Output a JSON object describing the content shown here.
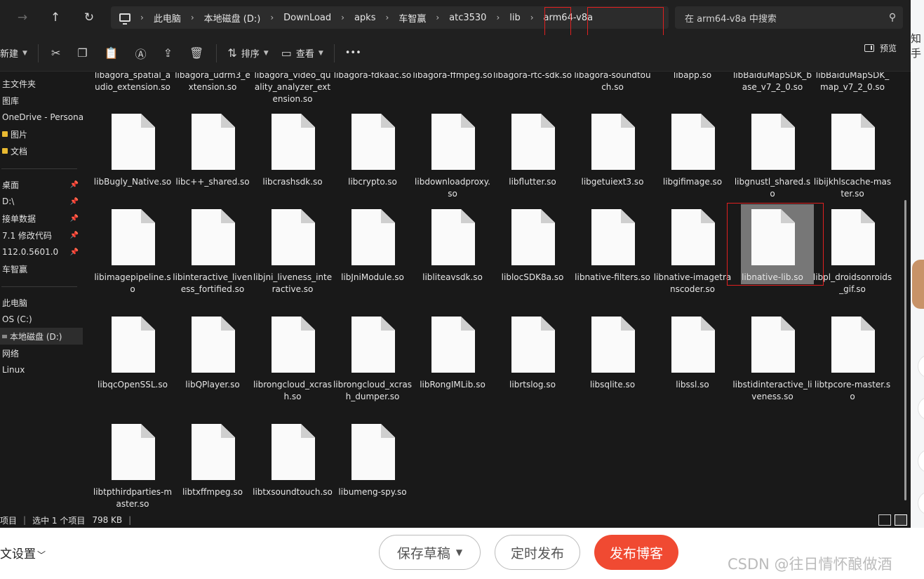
{
  "background": {
    "right_edge_text": "知手",
    "article_settings": "文设置",
    "save_draft": "保存草稿",
    "schedule": "定时发布",
    "publish": "发布博客",
    "watermark": "CSDN @往日情怀酿做酒"
  },
  "address_bar": {
    "breadcrumbs": [
      "此电脑",
      "本地磁盘 (D:)",
      "DownLoad",
      "apks",
      "车智赢",
      "atc3530",
      "lib",
      "arm64-v8a"
    ],
    "search_placeholder": "在 arm64-v8a 中搜索"
  },
  "toolbar": {
    "new": "新建",
    "sort": "排序",
    "view": "查看",
    "more": "•••",
    "preview": "预览"
  },
  "sidebar": {
    "items": [
      "主文件夹",
      "图库",
      "OneDrive - Persona",
      "图片",
      "文档",
      "桌面",
      "D:\\",
      "接单数据",
      "7.1 修改代码",
      "112.0.5601.0",
      "车智赢",
      "此电脑",
      "OS (C:)",
      "本地磁盘 (D:)",
      "网络",
      "Linux"
    ]
  },
  "files": {
    "row0": [
      "libagora_spatial_audio_extension.so",
      "libagora_udrm3_extension.so",
      "libagora_video_quality_analyzer_extension.so",
      "libagora-fdkaac.so",
      "libagora-ffmpeg.so",
      "libagora-rtc-sdk.so",
      "libagora-soundtouch.so",
      "libapp.so",
      "libBaiduMapSDK_base_v7_2_0.so",
      "libBaiduMapSDK_map_v7_2_0.so"
    ],
    "row1": [
      "libBugly_Native.so",
      "libc++_shared.so",
      "libcrashsdk.so",
      "libcrypto.so",
      "libdownloadproxy.so",
      "libflutter.so",
      "libgetuiext3.so",
      "libgifimage.so",
      "libgnustl_shared.so",
      "libijkhlscache-master.so"
    ],
    "row2": [
      "libimagepipeline.so",
      "libinteractive_liveness_fortified.so",
      "libjni_liveness_interactive.so",
      "libJniModule.so",
      "libliteavsdk.so",
      "liblocSDK8a.so",
      "libnative-filters.so",
      "libnative-imagetranscoder.so",
      "libnative-lib.so",
      "libpl_droidsonroids_gif.so"
    ],
    "row3": [
      "libqcOpenSSL.so",
      "libQPlayer.so",
      "librongcloud_xcrash.so",
      "librongcloud_xcrash_dumper.so",
      "libRongIMLib.so",
      "librtslog.so",
      "libsqlite.so",
      "libssl.so",
      "libstidinteractive_liveness.so",
      "libtpcore-master.so"
    ],
    "row4": [
      "libtpthirdparties-master.so",
      "libtxffmpeg.so",
      "libtxsoundtouch.so",
      "libumeng-spy.so"
    ]
  },
  "status": {
    "items_suffix": "项目",
    "selected": "选中 1 个项目",
    "size": "798 KB"
  },
  "icons": [
    "monitor-icon",
    "search-icon",
    "cut-icon",
    "copy-icon",
    "paste-icon",
    "rename-icon",
    "share-icon",
    "delete-icon",
    "sort-icon",
    "view-icon",
    "preview-pane-icon",
    "file-icon",
    "pin-icon"
  ]
}
